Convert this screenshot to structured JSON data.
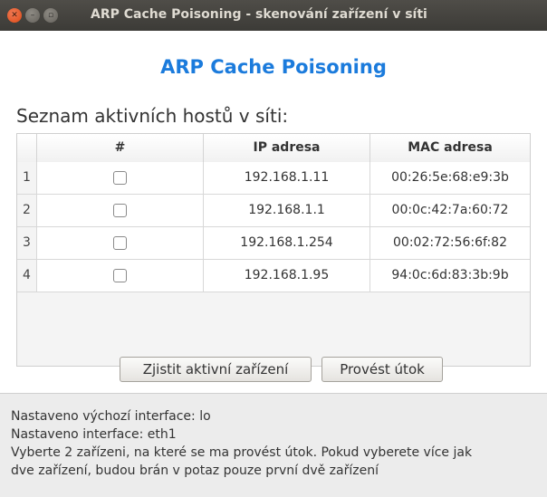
{
  "window": {
    "title": "ARP Cache Poisoning - skenování zařízení v síti"
  },
  "header": {
    "title": "ARP Cache Poisoning"
  },
  "hosts_label": "Seznam aktivních hostů v síti:",
  "table": {
    "columns": [
      "#",
      "IP adresa",
      "MAC adresa"
    ],
    "rows": [
      {
        "num": "1",
        "ip": "192.168.1.11",
        "mac": "00:26:5e:68:e9:3b",
        "checked": false
      },
      {
        "num": "2",
        "ip": "192.168.1.1",
        "mac": "00:0c:42:7a:60:72",
        "checked": false
      },
      {
        "num": "3",
        "ip": "192.168.1.254",
        "mac": "00:02:72:56:6f:82",
        "checked": false
      },
      {
        "num": "4",
        "ip": "192.168.1.95",
        "mac": "94:0c:6d:83:3b:9b",
        "checked": false
      }
    ]
  },
  "buttons": {
    "scan": "Zjistit aktivní zařízení",
    "attack": "Provést útok"
  },
  "log": [
    "Nastaveno výchozí interface: lo",
    "Nastaveno interface: eth1",
    "Vyberte 2 zařízeni, na které se ma provést útok. Pokud vyberete více jak",
    "dve zařízení, budou brán v potaz pouze první dvě zařízení"
  ]
}
